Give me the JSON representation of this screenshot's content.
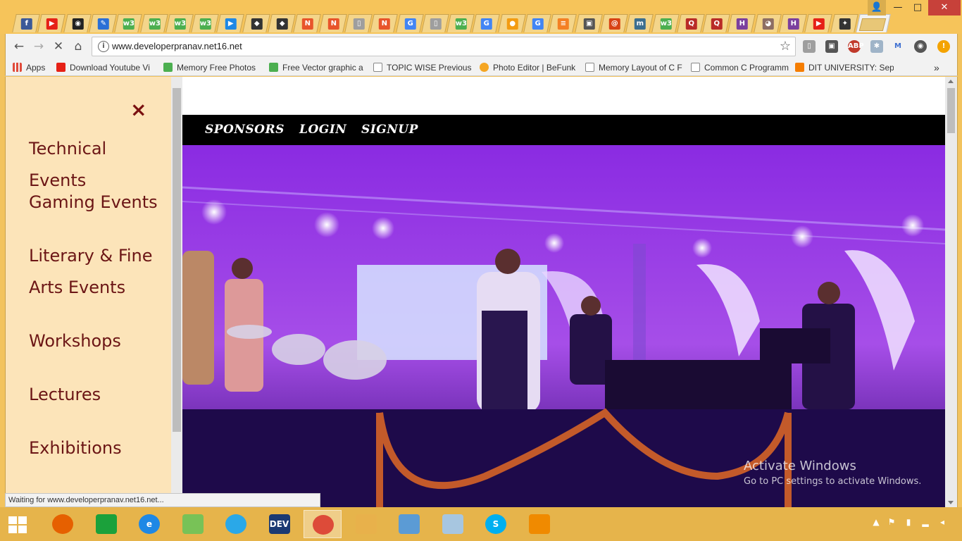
{
  "browser": {
    "tabs": [
      {
        "icon": "facebook-icon",
        "glyph": "f",
        "color": "#3b5998"
      },
      {
        "icon": "youtube-icon",
        "glyph": "▶",
        "color": "#e62117"
      },
      {
        "icon": "github-icon",
        "glyph": "◉",
        "color": "#222222"
      },
      {
        "icon": "pencil-icon",
        "glyph": "✎",
        "color": "#2a6fd6"
      },
      {
        "icon": "w3schools-icon",
        "glyph": "w3",
        "color": "#4caf50"
      },
      {
        "icon": "w3schools-icon",
        "glyph": "w3",
        "color": "#4caf50"
      },
      {
        "icon": "w3schools-icon",
        "glyph": "w3",
        "color": "#4caf50"
      },
      {
        "icon": "w3schools-icon",
        "glyph": "w3",
        "color": "#4caf50"
      },
      {
        "icon": "play-icon",
        "glyph": "▶",
        "color": "#1e88e5"
      },
      {
        "icon": "wolf-icon",
        "glyph": "◆",
        "color": "#333333"
      },
      {
        "icon": "wolf-icon",
        "glyph": "◆",
        "color": "#333333"
      },
      {
        "icon": "n-logo-icon",
        "glyph": "N",
        "color": "#e8542b"
      },
      {
        "icon": "n-logo-icon",
        "glyph": "N",
        "color": "#e8542b"
      },
      {
        "icon": "page-icon",
        "glyph": "▯",
        "color": "#9e9e9e"
      },
      {
        "icon": "n-logo-icon",
        "glyph": "N",
        "color": "#e8542b"
      },
      {
        "icon": "google-icon",
        "glyph": "G",
        "color": "#4285f4"
      },
      {
        "icon": "page-icon",
        "glyph": "▯",
        "color": "#9e9e9e"
      },
      {
        "icon": "w3schools-icon",
        "glyph": "w3",
        "color": "#4caf50"
      },
      {
        "icon": "google-icon",
        "glyph": "G",
        "color": "#4285f4"
      },
      {
        "icon": "orange-ball-icon",
        "glyph": "●",
        "color": "#f39c12"
      },
      {
        "icon": "google-icon",
        "glyph": "G",
        "color": "#4285f4"
      },
      {
        "icon": "stack-icon",
        "glyph": "≡",
        "color": "#f48024"
      },
      {
        "icon": "gfg-icon",
        "glyph": "▣",
        "color": "#555555"
      },
      {
        "icon": "swirl-icon",
        "glyph": "@",
        "color": "#d84315"
      },
      {
        "icon": "m-logo-icon",
        "glyph": "m",
        "color": "#3b6e8f"
      },
      {
        "icon": "w3schools-icon",
        "glyph": "w3",
        "color": "#4caf50"
      },
      {
        "icon": "quora-icon",
        "glyph": "Q",
        "color": "#b92b27"
      },
      {
        "icon": "quora-icon",
        "glyph": "Q",
        "color": "#b92b27"
      },
      {
        "icon": "hackerrank-icon",
        "glyph": "H",
        "color": "#7b3f9e"
      },
      {
        "icon": "owl-icon",
        "glyph": "◕",
        "color": "#8d6e63"
      },
      {
        "icon": "hackerrank-icon",
        "glyph": "H",
        "color": "#7b3f9e"
      },
      {
        "icon": "youtube-icon",
        "glyph": "▶",
        "color": "#e62117"
      },
      {
        "icon": "android-icon",
        "glyph": "✦",
        "color": "#333333"
      }
    ],
    "active_tab_close": "×",
    "window_controls": {
      "user": "👤",
      "minimize": "—",
      "maximize": "□",
      "close": "✕"
    },
    "url": "www.developerpranav.net16.net",
    "bookmarks": [
      {
        "label": "Apps",
        "icon": "apps-icon",
        "color": "#e04a3a"
      },
      {
        "label": "Download Youtube Vi",
        "icon": "youtube-icon",
        "color": "#e62117"
      },
      {
        "label": "Memory Free Photos",
        "icon": "download-arrow-icon",
        "color": "#4caf50"
      },
      {
        "label": "Free Vector graphic a",
        "icon": "download-arrow-icon",
        "color": "#4caf50"
      },
      {
        "label": "TOPIC WISE Previous",
        "icon": "page-icon",
        "color": "#ffffff"
      },
      {
        "label": "Photo Editor | BeFunk",
        "icon": "befunky-icon",
        "color": "#f5a623"
      },
      {
        "label": "Memory Layout of C F",
        "icon": "page-icon",
        "color": "#ffffff"
      },
      {
        "label": "Common C Programm",
        "icon": "page-icon",
        "color": "#ffffff"
      },
      {
        "label": "DIT UNIVERSITY: Sept",
        "icon": "blogger-icon",
        "color": "#f57d00"
      }
    ],
    "bookmarks_overflow": "»",
    "status": "Waiting for www.developerpranav.net16.net..."
  },
  "site": {
    "side_nav": {
      "close_glyph": "×",
      "items": [
        "Technical Events",
        "Gaming Events",
        "Literary & Fine Arts Events",
        "Workshops",
        "Lectures",
        "Exhibitions"
      ]
    },
    "top_nav": [
      "SPONSORS",
      "LOGIN",
      "SIGNUP"
    ],
    "hero_color": "#7a1cd9"
  },
  "watermark": {
    "title": "Activate Windows",
    "subtitle": "Go to PC settings to activate Windows."
  },
  "taskbar": {
    "apps": [
      {
        "name": "firefox-icon",
        "color": "#e66000",
        "glyph": ""
      },
      {
        "name": "store-icon",
        "color": "#1ba13b",
        "glyph": ""
      },
      {
        "name": "internet-explorer-icon",
        "color": "#1e88e5",
        "glyph": "e"
      },
      {
        "name": "android-studio-icon",
        "color": "#78c257",
        "glyph": ""
      },
      {
        "name": "shareit-icon",
        "color": "#2aa8e8",
        "glyph": ""
      },
      {
        "name": "devcpp-icon",
        "color": "#1b3a73",
        "glyph": "DEV"
      },
      {
        "name": "chrome-icon",
        "color": "#dd4b39",
        "glyph": ""
      },
      {
        "name": "file-explorer-icon",
        "color": "#e8b14b",
        "glyph": ""
      },
      {
        "name": "photos-icon",
        "color": "#5b9bd5",
        "glyph": ""
      },
      {
        "name": "notepad-icon",
        "color": "#a7c6e0",
        "glyph": ""
      },
      {
        "name": "skype-icon",
        "color": "#00aff0",
        "glyph": "S"
      },
      {
        "name": "vlc-icon",
        "color": "#f08a00",
        "glyph": ""
      }
    ]
  }
}
